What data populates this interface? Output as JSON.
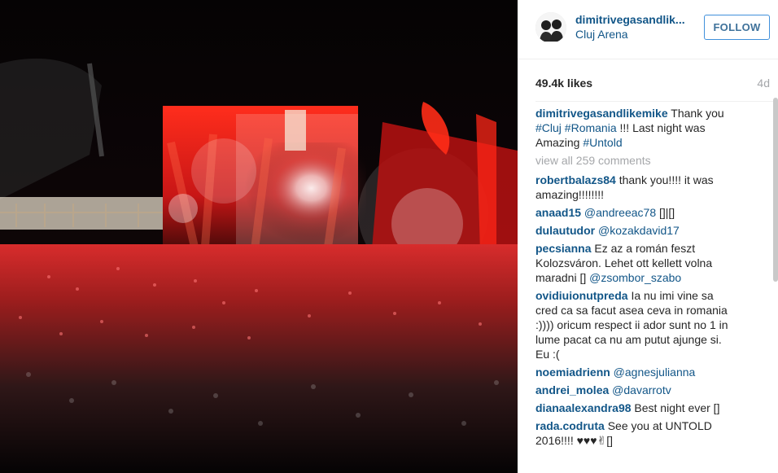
{
  "post": {
    "username": "dimitrivegasandlik...",
    "location": "Cluj Arena",
    "follow_label": "FOLLOW",
    "likes": "49.4k likes",
    "age": "4d"
  },
  "caption": {
    "user": "dimitrivegasandlikemike",
    "text_1": " Thank you ",
    "tag_cluj": "#Cluj",
    "tag_romania": "#Romania",
    "text_2": " !!! Last night was Amazing ",
    "tag_untold": "#Untold"
  },
  "view_all": "view all 259 comments",
  "comments": [
    {
      "user": "robertbalazs84",
      "text": " thank you!!!! it was amazing!!!!!!!!",
      "mention": ""
    },
    {
      "user": "anaad15",
      "text": "",
      "mention": " @andreeac78",
      "suffix": " []|[]"
    },
    {
      "user": "dulautudor",
      "text": "",
      "mention": " @kozakdavid17"
    },
    {
      "user": "pecsianna",
      "text": " Ez az a román feszt Kolozsváron. Lehet ott kellett volna maradni [] ",
      "mention": "@zsombor_szabo"
    },
    {
      "user": "ovidiuionutpreda",
      "text": " Ia nu imi vine sa cred ca sa facut asea ceva in romania :)))) oricum respect ii ador sunt no 1 in lume pacat ca nu am putut ajunge si. Eu :(",
      "mention": ""
    },
    {
      "user": "noemiadrienn",
      "text": "",
      "mention": " @agnesjulianna"
    },
    {
      "user": "andrei_molea",
      "text": "",
      "mention": " @davarrotv"
    },
    {
      "user": "dianaalexandra98",
      "text": " Best night ever []",
      "mention": ""
    },
    {
      "user": "rada.codruta",
      "text": " See you at UNTOLD 2016!!!! ♥♥♥✌[]",
      "mention": ""
    }
  ],
  "colors": {
    "link": "#125688",
    "follow_text": "#3f729b",
    "muted": "#a5a7aa"
  }
}
